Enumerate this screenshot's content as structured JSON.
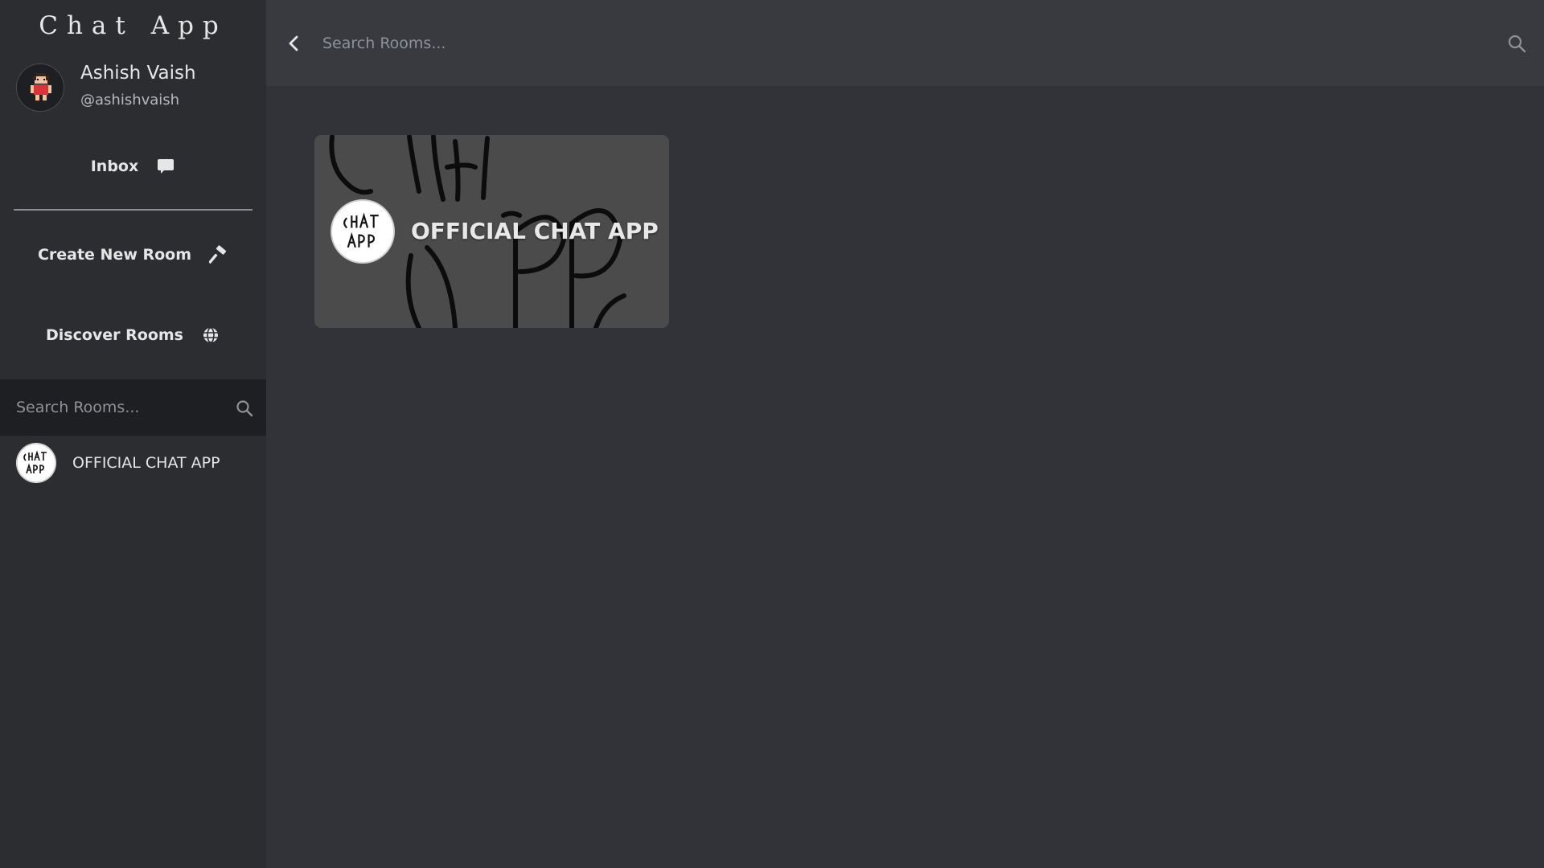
{
  "app": {
    "title": "Chat App"
  },
  "profile": {
    "name": "Ashish Vaish",
    "handle": "@ashishvaish",
    "avatar_icon": "pixel-character-avatar"
  },
  "nav": {
    "inbox_label": "Inbox",
    "inbox_icon": "chat-bubble-icon",
    "create_label": "Create New Room",
    "create_icon": "hammer-icon",
    "discover_label": "Discover Rooms",
    "discover_icon": "globe-icon"
  },
  "sidebar_search": {
    "placeholder": "Search Rooms..."
  },
  "rooms": [
    {
      "name": "OFFICIAL CHAT APP",
      "avatar_text": "CHAT APP"
    }
  ],
  "topbar": {
    "placeholder": "Search Rooms..."
  },
  "room_card": {
    "title": "OFFICIAL CHAT APP"
  },
  "colors": {
    "background": "#313338",
    "sidebar": "#2b2d31",
    "topbar": "#383a40",
    "search_bar": "#1e1f22",
    "card": "#4a4a4a"
  }
}
